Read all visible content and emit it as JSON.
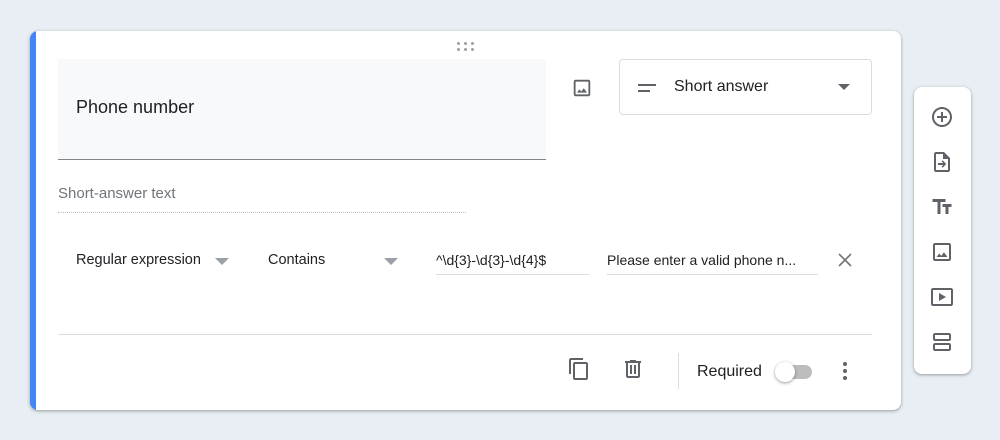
{
  "question": {
    "title": "Phone number",
    "type_label": "Short answer",
    "answer_placeholder": "Short-answer text"
  },
  "validation": {
    "type_label": "Regular expression",
    "condition_label": "Contains",
    "pattern": "^\\d{3}-\\d{3}-\\d{4}$",
    "error_text": "Please enter a valid phone n..."
  },
  "footer": {
    "required_label": "Required",
    "required_on": false
  },
  "icons": {
    "drag": "drag-handle-icon",
    "image": "image-icon",
    "type": "short-text-icon",
    "dropdown": "arrow-drop-down-icon",
    "clear": "close-icon",
    "duplicate": "content-copy-icon",
    "delete": "delete-icon",
    "more": "more-vert-icon",
    "add_question": "add-circle-icon",
    "import": "import-questions-icon",
    "title": "title-and-description-icon",
    "add_image": "image-icon",
    "add_video": "video-icon",
    "add_section": "section-icon"
  },
  "colors": {
    "accent": "#4285f4",
    "background": "#e8eef3",
    "icon": "#5f6368"
  }
}
